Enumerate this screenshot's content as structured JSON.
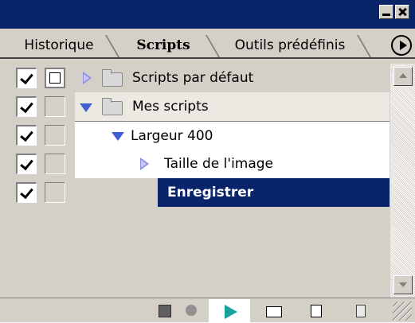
{
  "panel": {
    "tabs": [
      {
        "label": "Historique",
        "active": false
      },
      {
        "label": "Scripts",
        "active": true
      },
      {
        "label": "Outils prédéfinis",
        "active": false
      }
    ]
  },
  "list": {
    "items": [
      {
        "label": "Scripts par défaut",
        "checked": true,
        "dialog_toggle": true,
        "expanded": false,
        "type": "set"
      },
      {
        "label": "Mes scripts",
        "checked": true,
        "dialog_toggle": false,
        "expanded": true,
        "type": "set"
      },
      {
        "label": "Largeur 400",
        "checked": true,
        "dialog_toggle": false,
        "expanded": true,
        "type": "script"
      },
      {
        "label": "Taille de l'image",
        "checked": true,
        "dialog_toggle": false,
        "expanded": false,
        "type": "command"
      },
      {
        "label": "Enregistrer",
        "checked": true,
        "dialog_toggle": false,
        "selected": true,
        "type": "command"
      }
    ]
  },
  "colors": {
    "title_bar": "#0a246a",
    "selection": "#0a246a",
    "panel_bg": "#d4d0c8",
    "play_icon": "#19a0a0"
  },
  "toolbar": {
    "buttons": [
      "stop-icon",
      "record-icon",
      "play-icon",
      "new-set-icon",
      "new-script-icon",
      "delete-icon"
    ]
  }
}
